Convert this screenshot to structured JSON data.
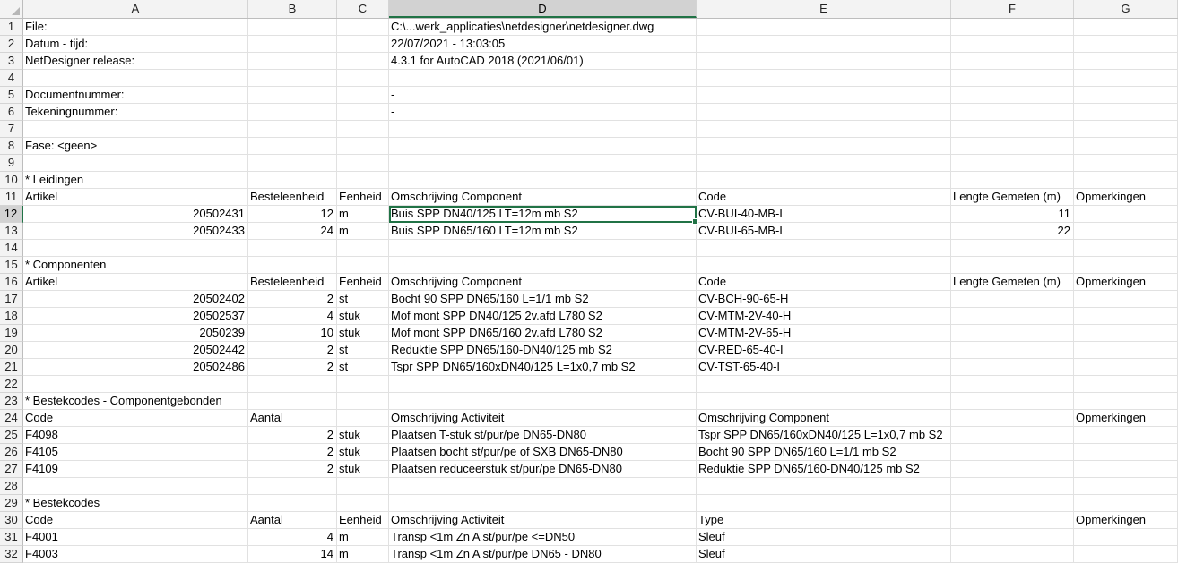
{
  "columns": [
    "A",
    "B",
    "C",
    "D",
    "E",
    "F",
    "G"
  ],
  "selected_column": "D",
  "selected_row": 12,
  "rows": [
    {
      "n": "1",
      "a": "File:",
      "b": "",
      "c": "",
      "d": "C:\\...werk_applicaties\\netdesigner\\netdesigner.dwg",
      "e": "",
      "f": "",
      "g": ""
    },
    {
      "n": "2",
      "a": "Datum - tijd:",
      "b": "",
      "c": "",
      "d": "22/07/2021 - 13:03:05",
      "e": "",
      "f": "",
      "g": ""
    },
    {
      "n": "3",
      "a": "NetDesigner release:",
      "b": "",
      "c": "",
      "d": "4.3.1 for AutoCAD 2018 (2021/06/01)",
      "e": "",
      "f": "",
      "g": ""
    },
    {
      "n": "4",
      "a": "",
      "b": "",
      "c": "",
      "d": "",
      "e": "",
      "f": "",
      "g": ""
    },
    {
      "n": "5",
      "a": "Documentnummer:",
      "b": "",
      "c": "",
      "d": "-",
      "e": "",
      "f": "",
      "g": ""
    },
    {
      "n": "6",
      "a": "Tekeningnummer:",
      "b": "",
      "c": "",
      "d": "-",
      "e": "",
      "f": "",
      "g": ""
    },
    {
      "n": "7",
      "a": "",
      "b": "",
      "c": "",
      "d": "",
      "e": "",
      "f": "",
      "g": ""
    },
    {
      "n": "8",
      "a": "Fase: <geen>",
      "b": "",
      "c": "",
      "d": "",
      "e": "",
      "f": "",
      "g": ""
    },
    {
      "n": "9",
      "a": "",
      "b": "",
      "c": "",
      "d": "",
      "e": "",
      "f": "",
      "g": ""
    },
    {
      "n": "10",
      "a": "*  Leidingen",
      "b": "",
      "c": "",
      "d": "",
      "e": "",
      "f": "",
      "g": ""
    },
    {
      "n": "11",
      "a": "Artikel",
      "b": "Besteleenheid",
      "c": "Eenheid",
      "d": "Omschrijving Component",
      "e": "Code",
      "f": "Lengte Gemeten (m)",
      "g": "Opmerkingen"
    },
    {
      "n": "12",
      "a": "20502431",
      "b": "12",
      "c": "m",
      "d": "Buis SPP DN40/125 LT=12m mb S2",
      "e": "CV-BUI-40-MB-I",
      "f": "11",
      "g": ""
    },
    {
      "n": "13",
      "a": "20502433",
      "b": "24",
      "c": "m",
      "d": "Buis SPP DN65/160 LT=12m mb S2",
      "e": "CV-BUI-65-MB-I",
      "f": "22",
      "g": ""
    },
    {
      "n": "14",
      "a": "",
      "b": "",
      "c": "",
      "d": "",
      "e": "",
      "f": "",
      "g": ""
    },
    {
      "n": "15",
      "a": "*  Componenten",
      "b": "",
      "c": "",
      "d": "",
      "e": "",
      "f": "",
      "g": ""
    },
    {
      "n": "16",
      "a": "Artikel",
      "b": "Besteleenheid",
      "c": "Eenheid",
      "d": "Omschrijving Component",
      "e": "Code",
      "f": "Lengte Gemeten (m)",
      "g": "Opmerkingen"
    },
    {
      "n": "17",
      "a": "20502402",
      "b": "2",
      "c": "st",
      "d": "Bocht 90 SPP DN65/160 L=1/1 mb S2",
      "e": "CV-BCH-90-65-H",
      "f": "",
      "g": ""
    },
    {
      "n": "18",
      "a": "20502537",
      "b": "4",
      "c": "stuk",
      "d": "Mof mont SPP DN40/125 2v.afd L780 S2",
      "e": "CV-MTM-2V-40-H",
      "f": "",
      "g": ""
    },
    {
      "n": "19",
      "a": "2050239",
      "b": "10",
      "c": "stuk",
      "d": "Mof mont SPP DN65/160 2v.afd L780 S2",
      "e": "CV-MTM-2V-65-H",
      "f": "",
      "g": ""
    },
    {
      "n": "20",
      "a": "20502442",
      "b": "2",
      "c": "st",
      "d": "Reduktie SPP DN65/160-DN40/125 mb S2",
      "e": "CV-RED-65-40-I",
      "f": "",
      "g": ""
    },
    {
      "n": "21",
      "a": "20502486",
      "b": "2",
      "c": "st",
      "d": "Tspr SPP DN65/160xDN40/125 L=1x0,7 mb S2",
      "e": "CV-TST-65-40-I",
      "f": "",
      "g": ""
    },
    {
      "n": "22",
      "a": "",
      "b": "",
      "c": "",
      "d": "",
      "e": "",
      "f": "",
      "g": ""
    },
    {
      "n": "23",
      "a": "*  Bestekcodes - Componentgebonden",
      "b": "",
      "c": "",
      "d": "",
      "e": "",
      "f": "",
      "g": ""
    },
    {
      "n": "24",
      "a": "Code",
      "b": "Aantal",
      "c": "",
      "d": "Omschrijving Activiteit",
      "e": "Omschrijving Component",
      "f": "",
      "g": "Opmerkingen"
    },
    {
      "n": "25",
      "a": "F4098",
      "b": "2",
      "c": "stuk",
      "d": "Plaatsen T-stuk st/pur/pe DN65-DN80",
      "e": "Tspr SPP DN65/160xDN40/125 L=1x0,7 mb S2",
      "f": "",
      "g": ""
    },
    {
      "n": "26",
      "a": "F4105",
      "b": "2",
      "c": "stuk",
      "d": "Plaatsen bocht st/pur/pe of SXB DN65-DN80",
      "e": "Bocht 90 SPP DN65/160 L=1/1 mb S2",
      "f": "",
      "g": ""
    },
    {
      "n": "27",
      "a": "F4109",
      "b": "2",
      "c": "stuk",
      "d": "Plaatsen reduceerstuk st/pur/pe DN65-DN80",
      "e": "Reduktie SPP DN65/160-DN40/125 mb S2",
      "f": "",
      "g": ""
    },
    {
      "n": "28",
      "a": "",
      "b": "",
      "c": "",
      "d": "",
      "e": "",
      "f": "",
      "g": ""
    },
    {
      "n": "29",
      "a": "*  Bestekcodes",
      "b": "",
      "c": "",
      "d": "",
      "e": "",
      "f": "",
      "g": ""
    },
    {
      "n": "30",
      "a": "Code",
      "b": "Aantal",
      "c": "Eenheid",
      "d": "Omschrijving Activiteit",
      "e": "Type",
      "f": "",
      "g": "Opmerkingen"
    },
    {
      "n": "31",
      "a": "F4001",
      "b": "4",
      "c": "m",
      "d": "Transp <1m Zn A st/pur/pe <=DN50",
      "e": "Sleuf",
      "f": "",
      "g": ""
    },
    {
      "n": "32",
      "a": "F4003",
      "b": "14",
      "c": "m",
      "d": "Transp <1m Zn A st/pur/pe DN65 - DN80",
      "e": "Sleuf",
      "f": "",
      "g": ""
    }
  ]
}
